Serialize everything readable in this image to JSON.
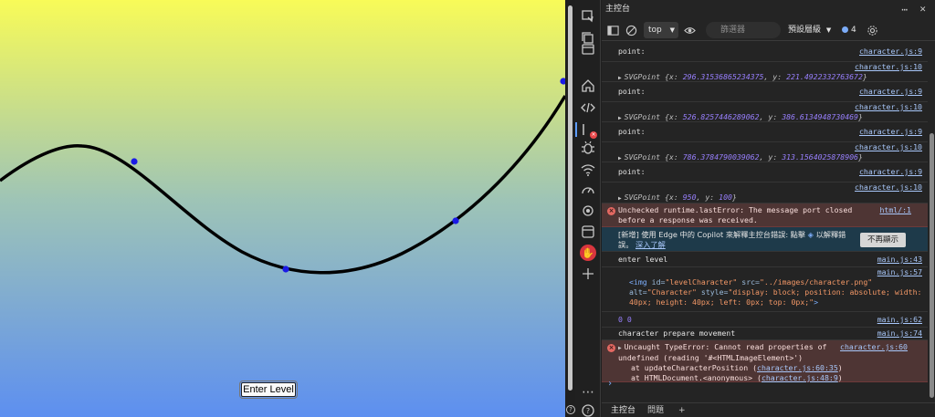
{
  "page": {
    "button_label": "Enter Level",
    "colors": {
      "gradient_top": "#f8fb58",
      "gradient_mid": "#9ec4b6",
      "gradient_bottom": "#5d8ff0",
      "curve": "#000000",
      "points": "#1a1ae6"
    }
  },
  "devtools": {
    "panel_title": "主控台",
    "toolbar": {
      "context": "top",
      "filter_placeholder": "篩選器",
      "level": "預設層級",
      "issues_count": "4"
    },
    "log": [
      {
        "type": "text",
        "text": "point:",
        "source": "character.js:9"
      },
      {
        "type": "object",
        "label": "SVGPoint",
        "x": "296.31536865234375",
        "y": "221.4922332763672",
        "source": "character.js:10"
      },
      {
        "type": "text",
        "text": "point:",
        "source": "character.js:9"
      },
      {
        "type": "object",
        "label": "SVGPoint",
        "x": "526.8257446289062",
        "y": "386.6134948730469",
        "source": "character.js:10"
      },
      {
        "type": "text",
        "text": "point:",
        "source": "character.js:9"
      },
      {
        "type": "object",
        "label": "SVGPoint",
        "x": "786.3784790039062",
        "y": "313.1564025878906",
        "source": "character.js:10"
      },
      {
        "type": "text",
        "text": "point:",
        "source": "character.js:9"
      },
      {
        "type": "object",
        "label": "SVGPoint",
        "x": "950",
        "y": "100",
        "source": "character.js:10"
      }
    ],
    "runtime_error": {
      "text": "Unchecked runtime.lastError: The message port closed before a response was received.",
      "source": "html/:1"
    },
    "copilot": {
      "text": "[新增] 使用 Edge 中的 Copilot 來解釋主控台錯誤: 點擊",
      "text2": "以解釋錯誤。",
      "link": "深入了解",
      "button": "不再顯示"
    },
    "enter_level": {
      "text": "enter level",
      "source": "main.js:43"
    },
    "img_log": {
      "source": "main.js:57",
      "tag_open": "<img",
      "id_attr": "id=",
      "id_val": "\"levelCharacter\"",
      "src_attr": "src=",
      "src_val": "\"../images/character.png\"",
      "alt_attr": "alt=",
      "alt_val": "\"Character\"",
      "style_attr": "style=",
      "style_val": "\"display: block; position: absolute; width: 40px; height: 40px; left: 0px; top: 0px;\"",
      "tag_close": ">"
    },
    "zero_log": {
      "text": "0 0",
      "source": "main.js:62"
    },
    "prepare": {
      "text": "character prepare movement",
      "source": "main.js:74"
    },
    "type_error": {
      "text": "Uncaught TypeError: Cannot read properties of undefined (reading '#<HTMLImageElement>')",
      "source": "character.js:60",
      "stack1_prefix": "at updateCharacterPosition (",
      "stack1_link": "character.js:60:35",
      "stack2_prefix": "at HTMLDocument.<anonymous> (",
      "stack2_link": "character.js:48:9",
      "stack_suffix": ")"
    },
    "prompt_symbol": "›",
    "bottom_tabs": [
      "主控台",
      "問題"
    ]
  }
}
